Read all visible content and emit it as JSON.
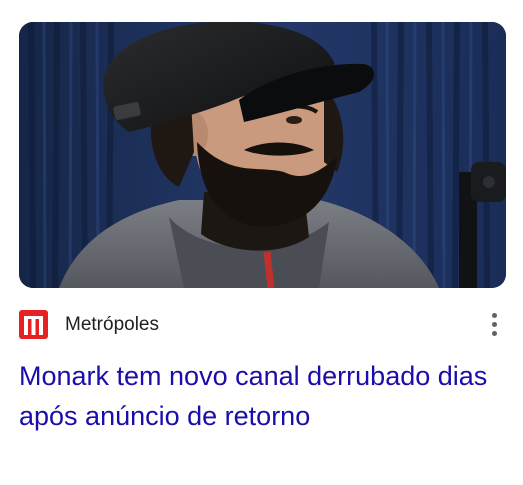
{
  "article": {
    "source": "Metrópoles",
    "headline": "Monark tem novo canal derrubado dias após anúncio de retorno",
    "image_alt": "Man with beard wearing a black cap in front of a blue curtain"
  },
  "colors": {
    "headline": "#1a0dab",
    "source_text": "#202124",
    "logo_red": "#e52121",
    "menu_dots": "#5f6368"
  },
  "icons": {
    "logo": "metropoles-logo-icon",
    "more": "more-vert-icon"
  }
}
